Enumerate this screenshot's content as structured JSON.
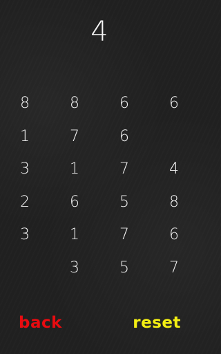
{
  "game": {
    "current_number": "4",
    "grid": [
      [
        "8",
        "8",
        "6",
        "6"
      ],
      [
        "1",
        "7",
        "6",
        ""
      ],
      [
        "3",
        "1",
        "7",
        "4"
      ],
      [
        "2",
        "6",
        "5",
        "8"
      ],
      [
        "3",
        "1",
        "7",
        "6"
      ],
      [
        "",
        "3",
        "5",
        "7"
      ]
    ]
  },
  "controls": {
    "back_label": "back",
    "reset_label": "reset"
  },
  "colors": {
    "background": "#202020",
    "chalk": "#f4f4f4",
    "back": "#e80b10",
    "reset": "#f3ee13"
  }
}
